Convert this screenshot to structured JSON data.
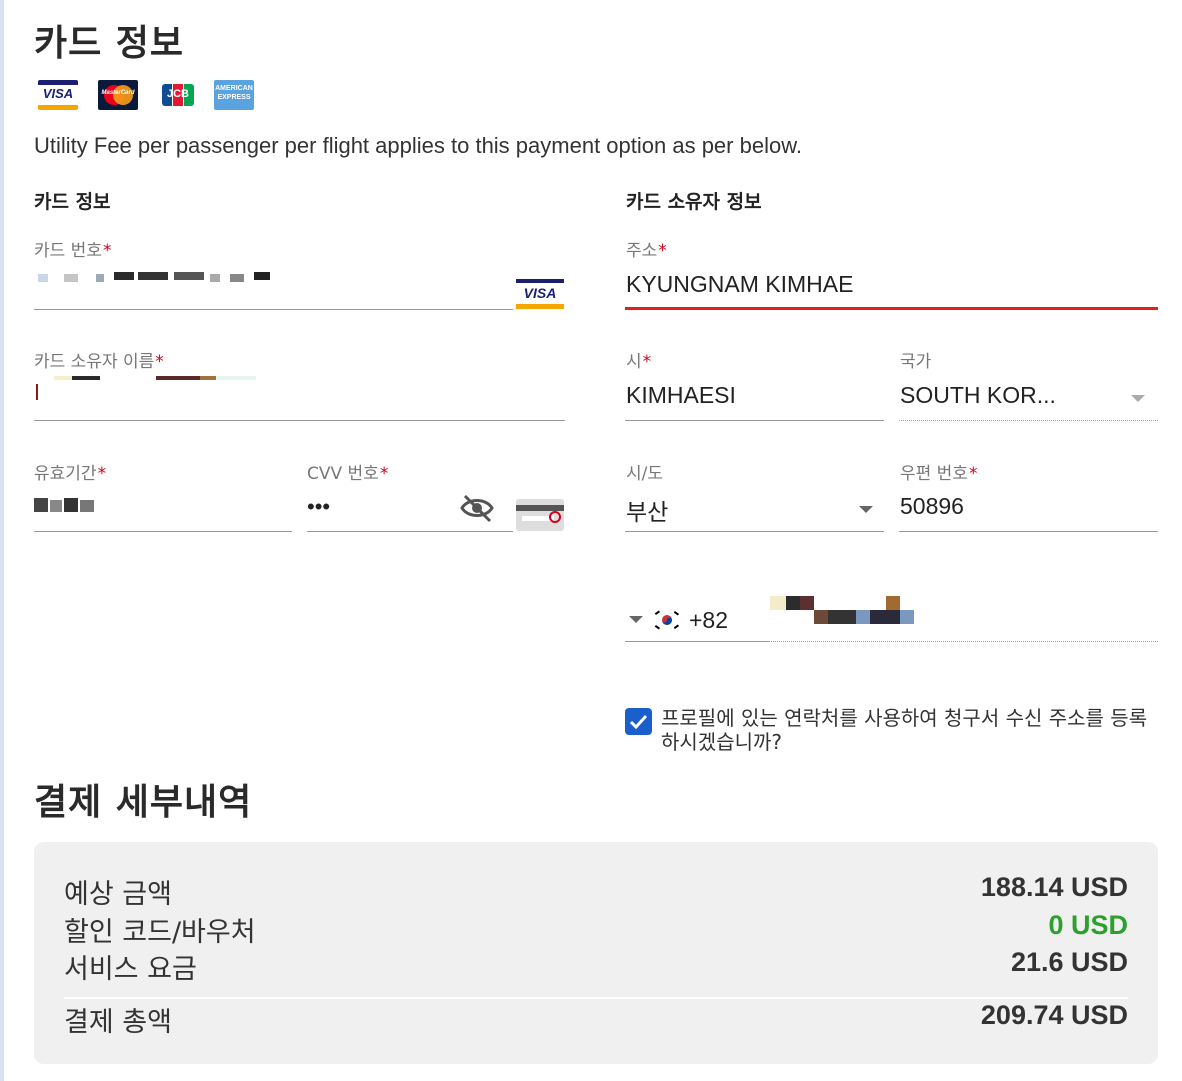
{
  "page_title": "카드 정보",
  "card_logos": [
    "VISA",
    "MasterCard",
    "JCB",
    "AMERICAN EXPRESS"
  ],
  "fee_note": "Utility Fee per passenger per flight applies to this payment option as per below.",
  "card_section": {
    "title": "카드 정보",
    "card_number": {
      "label": "카드 번호"
    },
    "holder_name": {
      "label": "카드 소유자 이름"
    },
    "expiry": {
      "label": "유효기간"
    },
    "cvv": {
      "label": "CVV 번호",
      "value": "•••"
    }
  },
  "holder_section": {
    "title": "카드 소유자 정보",
    "address": {
      "label": "주소",
      "value": "KYUNGNAM KIMHAE"
    },
    "city": {
      "label": "시",
      "value": "KIMHAESI"
    },
    "country": {
      "label": "국가",
      "value": "SOUTH KOR..."
    },
    "province": {
      "label": "시/도",
      "value": "부산"
    },
    "postal": {
      "label": "우편 번호",
      "value": "50896"
    },
    "phone": {
      "country_code": "+82"
    },
    "use_profile_checkbox": {
      "label": "프로필에 있는 연락처를 사용하여 청구서 수신 주소를 등록하시겠습니까?",
      "checked": true
    }
  },
  "payment_details": {
    "title": "결제 세부내역",
    "rows": [
      {
        "label": "예상 금액",
        "value": "188.14 USD"
      },
      {
        "label": "할인 코드/바우처",
        "value": "0 USD",
        "color": "#2ca02c"
      },
      {
        "label": "서비스 요금",
        "value": "21.6 USD"
      }
    ],
    "total": {
      "label": "결제 총액",
      "value": "209.74 USD"
    }
  },
  "colors": {
    "accent": "#1a5fcc",
    "error": "#e02020",
    "required": "#d0021b",
    "discount": "#2ca02c"
  }
}
